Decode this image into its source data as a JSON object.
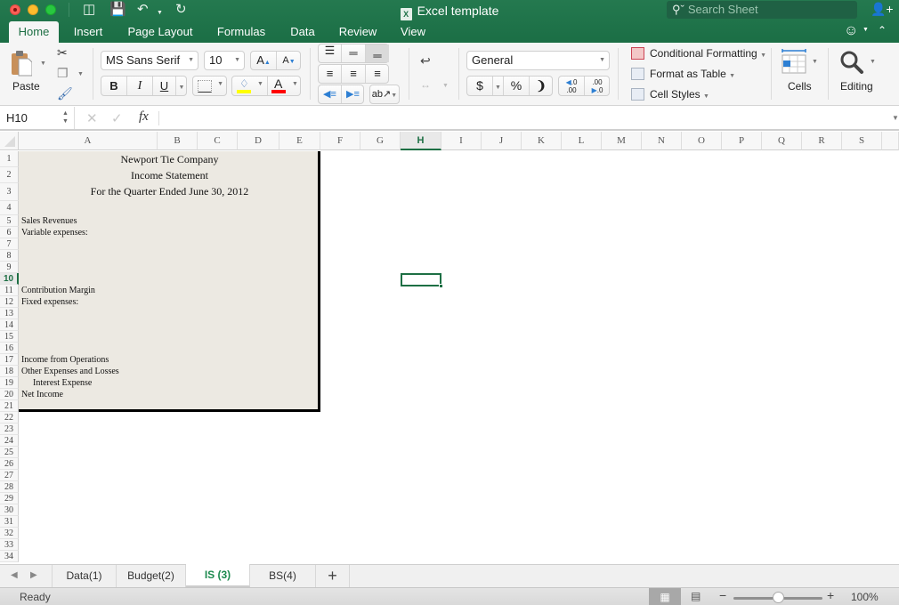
{
  "window": {
    "title": "Excel template",
    "search_placeholder": "Search Sheet"
  },
  "ribbon_tabs": [
    {
      "label": "Home",
      "active": true
    },
    {
      "label": "Insert"
    },
    {
      "label": "Page Layout"
    },
    {
      "label": "Formulas"
    },
    {
      "label": "Data"
    },
    {
      "label": "Review"
    },
    {
      "label": "View"
    }
  ],
  "ribbon": {
    "paste_label": "Paste",
    "font_name": "MS Sans Serif",
    "font_size": "10",
    "bold": "B",
    "italic": "I",
    "underline": "U",
    "number_format": "General",
    "currency": "$",
    "percent": "%",
    "comma": "❩",
    "increase_decimal": "←.0 .00",
    "decrease_decimal": ".00 →.0",
    "conditional_formatting": "Conditional Formatting",
    "format_as_table": "Format as Table",
    "cell_styles": "Cell Styles",
    "cells_label": "Cells",
    "editing_label": "Editing",
    "fill_color": "#ffff00",
    "font_color": "#ff0000"
  },
  "formula_bar": {
    "name_box": "H10",
    "fx": "fx",
    "formula": ""
  },
  "columns": [
    "A",
    "B",
    "C",
    "D",
    "E",
    "F",
    "G",
    "H",
    "I",
    "J",
    "K",
    "L",
    "M",
    "N",
    "O",
    "P",
    "Q",
    "R",
    "S"
  ],
  "selected_column": "H",
  "selected_row": "10",
  "rows": [
    "1",
    "2",
    "3",
    "4",
    "5",
    "6",
    "7",
    "8",
    "9",
    "10",
    "11",
    "12",
    "13",
    "14",
    "15",
    "16",
    "17",
    "18",
    "19",
    "20",
    "21",
    "22",
    "23",
    "24",
    "25",
    "26",
    "27",
    "28",
    "29",
    "30",
    "31",
    "32",
    "33",
    "34"
  ],
  "statement": {
    "company": "Newport Tie Company",
    "title": "Income Statement",
    "period": "For the Quarter Ended June 30, 2012",
    "lines": [
      {
        "row": 5,
        "text": "Sales Revenues"
      },
      {
        "row": 6,
        "text": "Variable expenses:"
      },
      {
        "row": 11,
        "text": "Contribution Margin"
      },
      {
        "row": 12,
        "text": "Fixed expenses:"
      },
      {
        "row": 17,
        "text": "Income from Operations"
      },
      {
        "row": 18,
        "text": "Other Expenses and Losses"
      },
      {
        "row": 19,
        "text": "Interest Expense",
        "indent": true
      },
      {
        "row": 20,
        "text": "Net Income"
      }
    ],
    "fill_color": "#ece9e2"
  },
  "sheet_tabs": [
    {
      "label": "Data(1)"
    },
    {
      "label": "Budget(2)"
    },
    {
      "label": "IS (3)",
      "active": true
    },
    {
      "label": "BS(4)"
    }
  ],
  "add_sheet": "+",
  "status": {
    "text": "Ready",
    "zoom": "100%",
    "zoom_level_percent": 100
  },
  "accent_color": "#1d6f44"
}
